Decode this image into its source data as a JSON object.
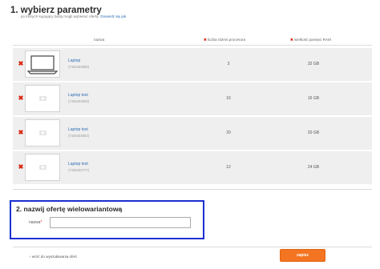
{
  "section1": {
    "title": "1. wybierz parametry",
    "subtitle": "po których kupujący będą mogli wybierać ofertę.",
    "learn_more": "Dowiedz się jak"
  },
  "table": {
    "col_name": "nazwa",
    "col_param1": "liczba rdzeni procesora",
    "col_param2": "wielkość pamięci RAM",
    "remove_glyph": "✖",
    "rows": [
      {
        "name": "Laptop",
        "id": "(7446434900)",
        "param1": "3",
        "param2": "32 GB",
        "image": "laptop-icon"
      },
      {
        "name": "Laptop test",
        "id": "(7446434603)",
        "param1": "16",
        "param2": "16 GB",
        "image": "image-placeholder-icon"
      },
      {
        "name": "Laptop test",
        "id": "(7446434602)",
        "param1": "20",
        "param2": "20 GB",
        "image": "image-placeholder-icon"
      },
      {
        "name": "Laptop test",
        "id": "(7446434777)",
        "param1": "12",
        "param2": "24 GB",
        "image": "image-placeholder-icon"
      }
    ]
  },
  "section2": {
    "title": "2. nazwij ofertę wielowariantową",
    "field_label": "nazwa",
    "required_mark": "*",
    "field_value": ""
  },
  "footer": {
    "back_link": "‹  wróć do wyszukiwania ofert",
    "submit_label": "zapisz"
  },
  "colors": {
    "accent": "#f37421",
    "link": "#2f6eb5",
    "remove": "#d9230f",
    "highlight_border": "#1b2fd2"
  }
}
